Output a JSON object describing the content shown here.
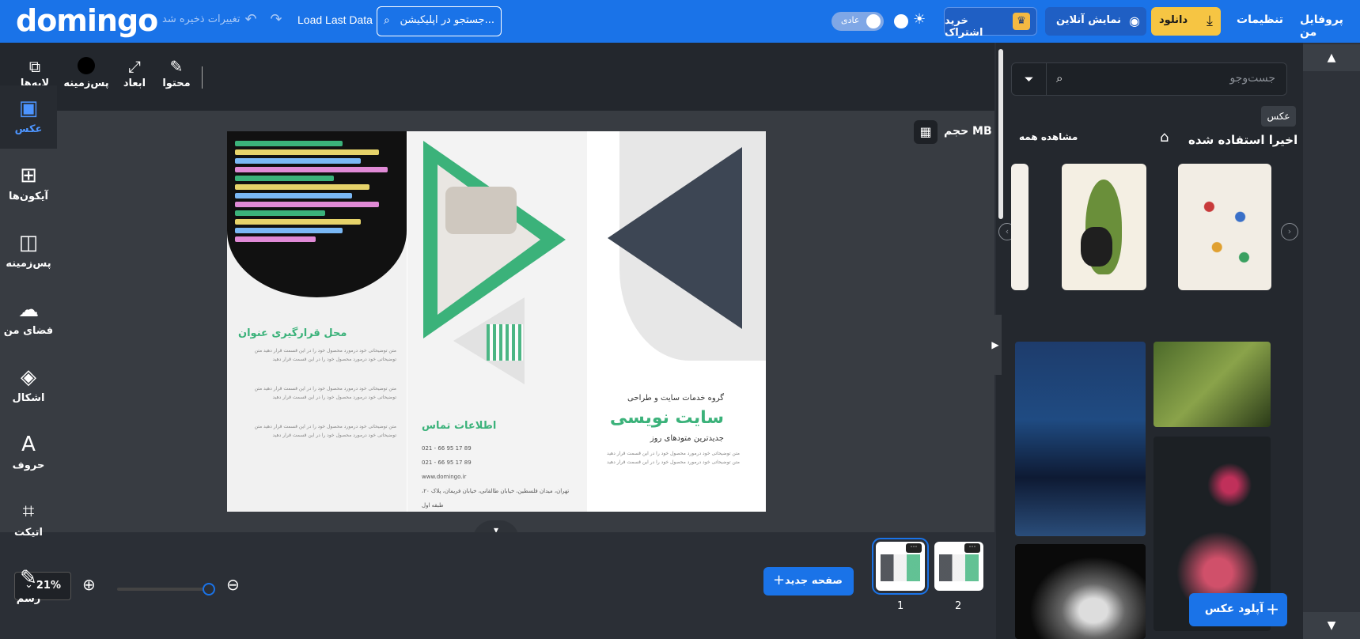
{
  "header": {
    "logo": "domingo",
    "saved_status": "تغییرات ذخیره شد",
    "load_last": "Load Last Data",
    "search_value": "جستجو در اپلیکیشن...",
    "mode_label": "عادی",
    "subscribe": "خرید اشتراک",
    "online_preview": "نمایش آنلاین",
    "download": "دانلود",
    "settings": "تنظیمات",
    "profile": "پروفایل من"
  },
  "toolbar": {
    "content": "محتوا",
    "dimensions": "ابعاد",
    "background": "پس‌زمینه",
    "layers": "لایه‌ها"
  },
  "canvas": {
    "size_label": "حجم MB"
  },
  "document": {
    "heading_left": "محل قرارگیری عنوان",
    "contact_title": "اطلاعات تماس",
    "phone1": "021 - 66 95 17 89",
    "phone2": "021 - 66 95 17 89",
    "website": "www.domingo.ir",
    "address": "تهران، میدان فلسطین، خیابان طالقانی، خیابان فریمان، پلاک ۲۰، طبقه اول",
    "group_title": "گروه خدمات سایت و طراحی",
    "main_title": "سایت نویسی",
    "subtitle": "جدیدترین متودهای روز",
    "body_text": "متن توضیحاتی خود درمورد محصول خود را در این قسمت قرار دهید متن توضیحاتی خود درمورد محصول خود را در این قسمت قرار دهید"
  },
  "bottom": {
    "zoom": "21%",
    "new_page": "صفحه جدید",
    "pages": [
      "1",
      "2"
    ]
  },
  "panel": {
    "search_placeholder": "جست‌وجو",
    "recent_title": "اخیرا استفاده شده",
    "see_all": "مشاهده همه",
    "tooltip": "عکس",
    "upload": "آپلود عکس"
  },
  "rail": [
    {
      "label": "عکس",
      "icon": "image-icon"
    },
    {
      "label": "آیکون‌ها",
      "icon": "grid-icon"
    },
    {
      "label": "پس‌زمینه",
      "icon": "background-icon"
    },
    {
      "label": "فضای من",
      "icon": "cloud-upload-icon"
    },
    {
      "label": "اشکال",
      "icon": "shapes-icon"
    },
    {
      "label": "حروف",
      "icon": "text-icon"
    },
    {
      "label": "اتیکت",
      "icon": "tag-icon"
    },
    {
      "label": "رسم",
      "icon": "pen-icon"
    }
  ],
  "colors": {
    "brand": "#1a73e8",
    "accent_green": "#3bb27a",
    "download_yellow": "#f6c543"
  }
}
